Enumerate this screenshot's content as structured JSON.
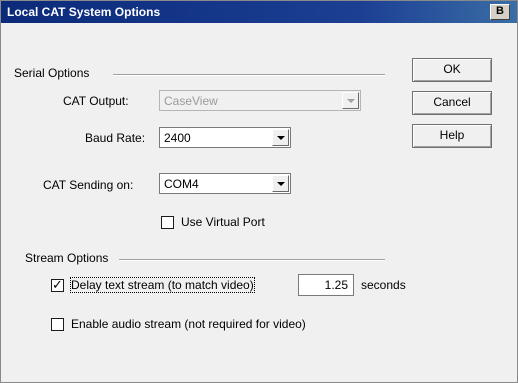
{
  "window": {
    "title": "Local CAT System Options",
    "restore_button": "B"
  },
  "serial": {
    "group_label": "Serial Options",
    "cat_output_label": "CAT Output:",
    "cat_output_value": "CaseView",
    "baud_rate_label": "Baud Rate:",
    "baud_rate_value": "2400",
    "cat_sending_label": "CAT Sending on:",
    "cat_sending_value": "COM4",
    "virtual_port_label": "Use Virtual Port",
    "virtual_port_checked": false
  },
  "stream": {
    "group_label": "Stream Options",
    "delay_label": "Delay text stream (to match video)",
    "delay_checked": true,
    "delay_value": "1.25",
    "delay_units": "seconds",
    "audio_label": "Enable audio stream (not required for video)",
    "audio_checked": false
  },
  "buttons": {
    "ok": "OK",
    "cancel": "Cancel",
    "help": "Help"
  }
}
